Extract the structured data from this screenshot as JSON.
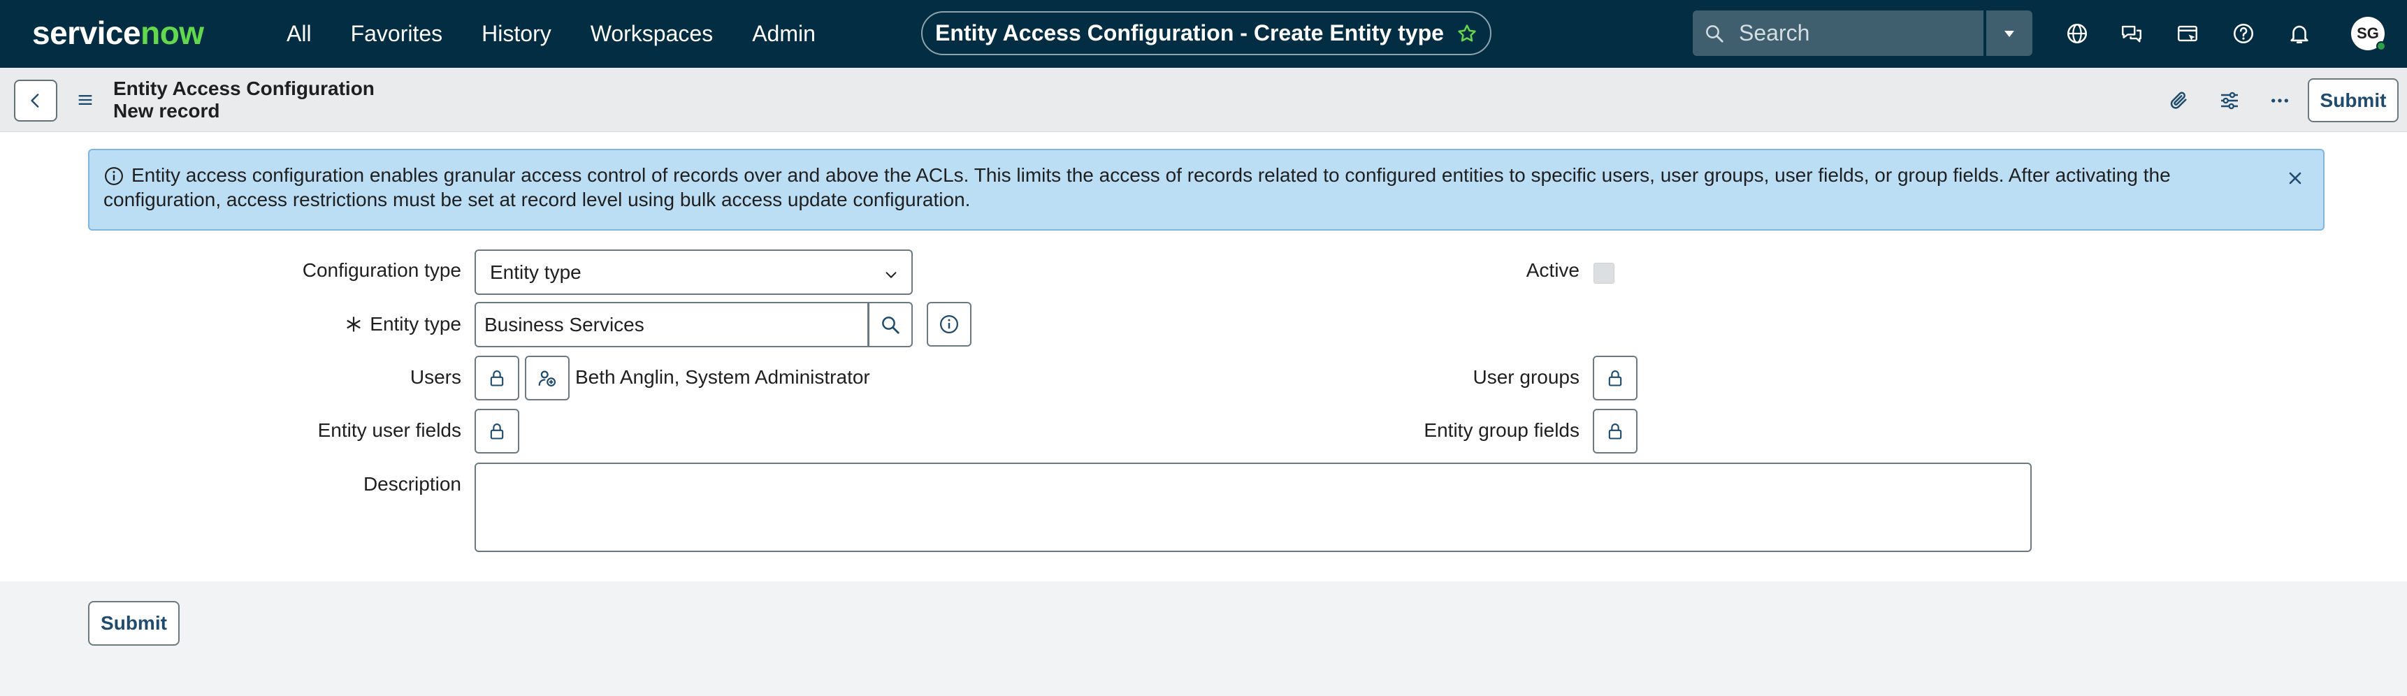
{
  "topnav": {
    "brand_service": "service",
    "brand_now": "now",
    "links": [
      "All",
      "Favorites",
      "History",
      "Workspaces",
      "Admin"
    ],
    "context_title": "Entity Access Configuration - Create Entity type",
    "search_placeholder": "Search",
    "avatar_initials": "SG",
    "icons": [
      "globe-icon",
      "chat-icon",
      "incident-icon",
      "help-icon",
      "bell-icon"
    ]
  },
  "header": {
    "title": "Entity Access Configuration",
    "subtitle": "New record",
    "submit_label": "Submit"
  },
  "banner": {
    "text": "Entity access configuration enables granular access control of records over and above the ACLs. This limits the access of records related to configured entities to specific users, user groups, user fields, or group fields. After activating the configuration, access restrictions must be set at record level using bulk access update configuration."
  },
  "form": {
    "configuration_type_label": "Configuration type",
    "configuration_type_value": "Entity type",
    "active_label": "Active",
    "active_checked": false,
    "entity_type_label": "Entity type",
    "entity_type_value": "Business Services",
    "users_label": "Users",
    "users_value": "Beth Anglin, System Administrator",
    "user_groups_label": "User groups",
    "entity_user_fields_label": "Entity user fields",
    "entity_group_fields_label": "Entity group fields",
    "description_label": "Description",
    "description_value": ""
  },
  "footer": {
    "submit_label": "Submit"
  },
  "colors": {
    "nav_bg": "#032d42",
    "brand_accent": "#62d84e",
    "banner_bg": "#bcdef5",
    "button_text": "#1f4b6e"
  }
}
